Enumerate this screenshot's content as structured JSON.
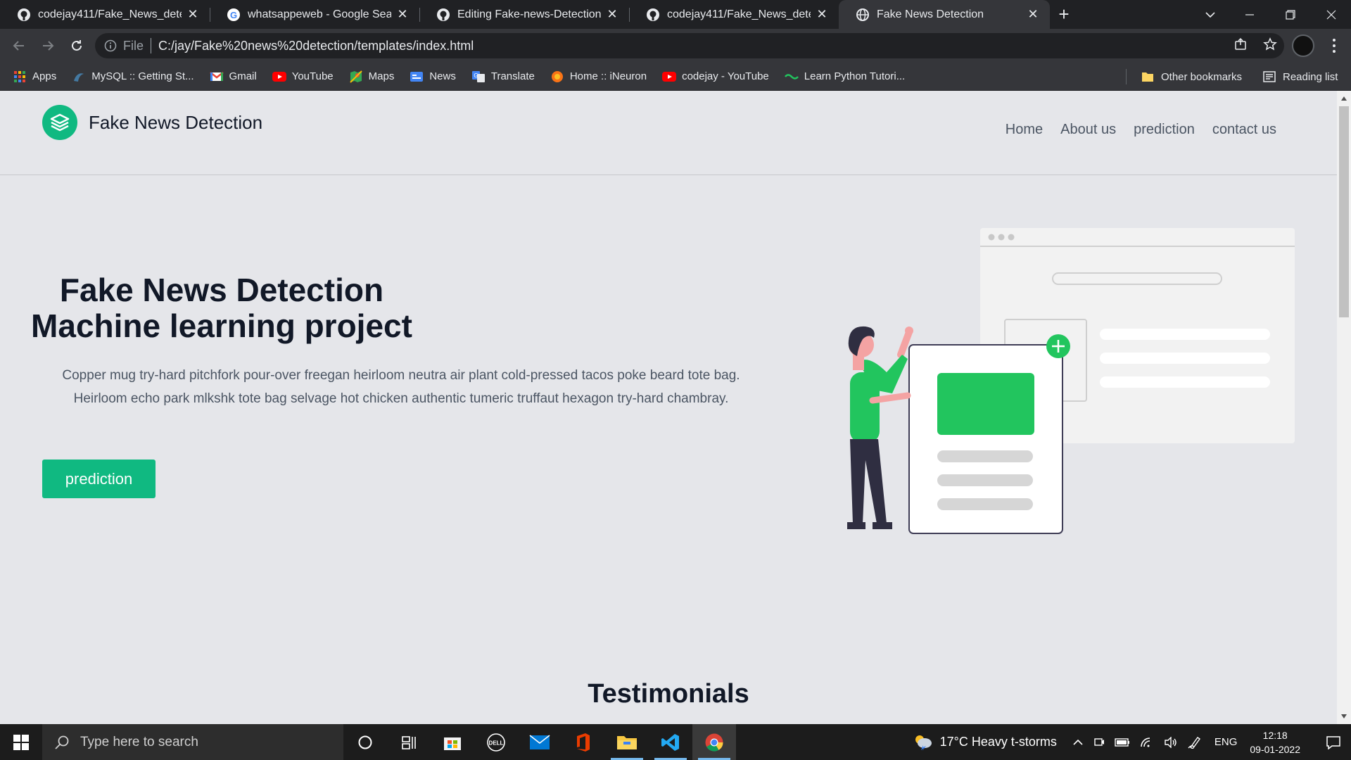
{
  "browser": {
    "tabs": [
      {
        "title": "codejay411/Fake_News_detection",
        "icon": "github-icon"
      },
      {
        "title": "whatsappeweb - Google Search",
        "icon": "google-icon"
      },
      {
        "title": "Editing Fake-news-Detection/README.md",
        "icon": "github-icon"
      },
      {
        "title": "codejay411/Fake_News_detection",
        "icon": "github-icon"
      },
      {
        "title": "Fake News Detection",
        "icon": "globe-icon",
        "active": true
      }
    ],
    "address": {
      "scheme": "File",
      "url": "C:/jay/Fake%20news%20detection/templates/index.html"
    },
    "bookmarks": [
      {
        "label": "Apps",
        "icon": "apps-grid-icon"
      },
      {
        "label": "MySQL :: Getting St...",
        "icon": "mysql-icon"
      },
      {
        "label": "Gmail",
        "icon": "gmail-icon"
      },
      {
        "label": "YouTube",
        "icon": "youtube-icon"
      },
      {
        "label": "Maps",
        "icon": "maps-icon"
      },
      {
        "label": "News",
        "icon": "google-news-icon"
      },
      {
        "label": "Translate",
        "icon": "translate-icon"
      },
      {
        "label": "Home :: iNeuron",
        "icon": "ineuron-icon"
      },
      {
        "label": "codejay - YouTube",
        "icon": "youtube-icon"
      },
      {
        "label": "Learn Python Tutori...",
        "icon": "python-icon"
      }
    ],
    "other_bookmarks": "Other bookmarks",
    "reading_list": "Reading list"
  },
  "page": {
    "brand": "Fake News Detection",
    "nav": [
      "Home",
      "About us",
      "prediction",
      "contact us"
    ],
    "hero": {
      "title_line1": "Fake News Detection",
      "title_line2": "Machine learning project",
      "text": "Copper mug try-hard pitchfork pour-over freegan heirloom neutra air plant cold-pressed tacos poke beard tote bag. Heirloom echo park mlkshk tote bag selvage hot chicken authentic tumeric truffaut hexagon try-hard chambray.",
      "button": "prediction"
    },
    "section_title": "Testimonials",
    "colors": {
      "accent": "#10b981",
      "illustration_green": "#22c55e",
      "text_dark": "#111827"
    }
  },
  "taskbar": {
    "search_placeholder": "Type here to search",
    "weather": "17°C  Heavy t-storms",
    "language": "ENG",
    "time": "12:18",
    "date": "09-01-2022"
  }
}
